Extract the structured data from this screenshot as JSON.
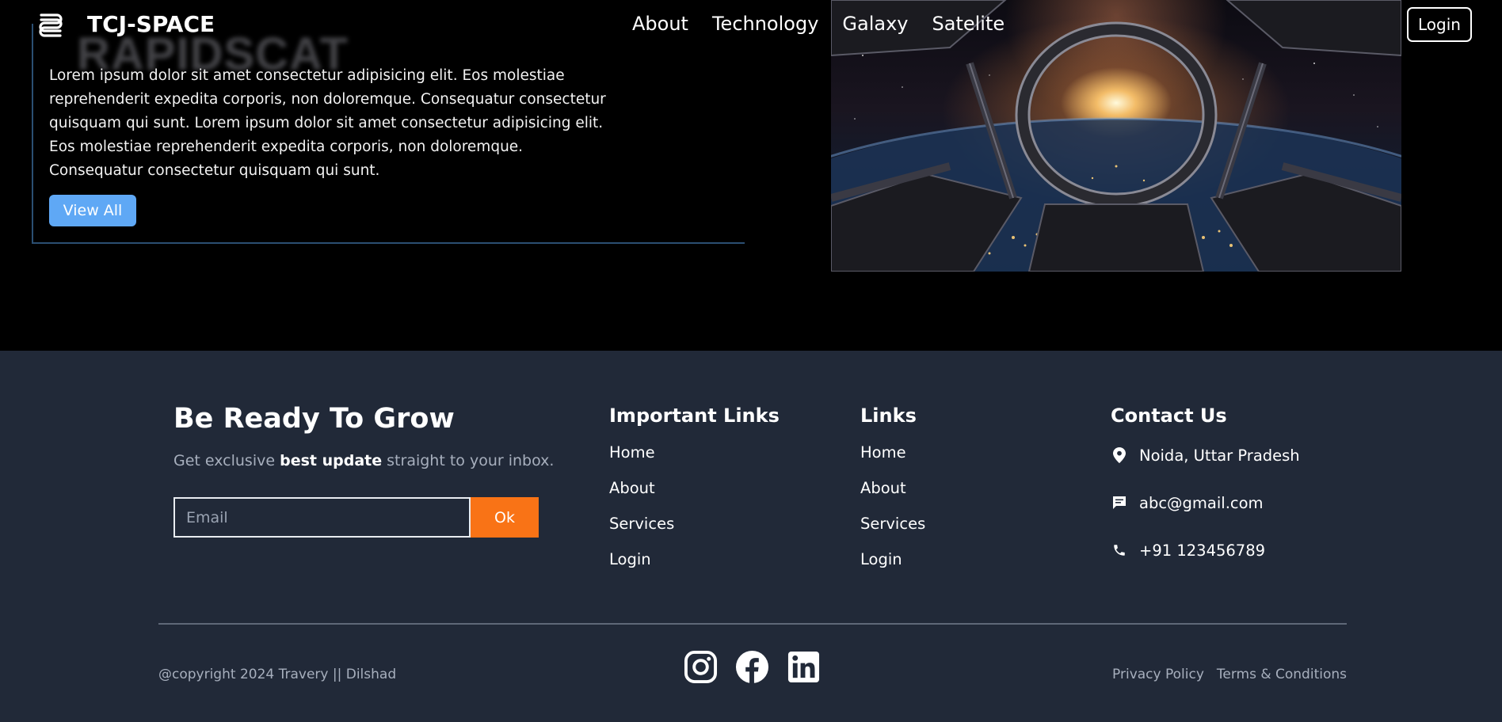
{
  "navbar": {
    "brand": "TCJ-SPACE",
    "links": [
      "About",
      "Technology",
      "Galaxy",
      "Satelite"
    ],
    "login_label": "Login"
  },
  "hero": {
    "ghost_word": "RAPIDSCAT",
    "paragraph": "Lorem ipsum dolor sit amet consectetur adipisicing elit. Eos molestiae reprehenderit expedita corporis, non doloremque. Consequatur consectetur quisquam qui sunt. Lorem ipsum dolor sit amet consectetur adipisicing elit. Eos molestiae reprehenderit expedita corporis, non doloremque. Consequatur consectetur quisquam qui sunt.",
    "button_label": "View All",
    "image_icon": "space-station-window-image"
  },
  "newsletter": {
    "title": "Be Ready To Grow",
    "subtitle_before": "Get exclusive",
    "subtitle_bold": "best update",
    "subtitle_after": "straight to your inbox.",
    "email_placeholder": "Email",
    "email_value": "",
    "ok_label": "Ok"
  },
  "important_links": {
    "title": "Important Links",
    "items": [
      "Home",
      "About",
      "Services",
      "Login"
    ]
  },
  "links": {
    "title": "Links",
    "items": [
      "Home",
      "About",
      "Services",
      "Login"
    ]
  },
  "contact": {
    "title": "Contact Us",
    "address": "Noida, Uttar Pradesh",
    "email": "abc@gmail.com",
    "phone": "+91 123456789",
    "icons": [
      "location-pin-icon",
      "message-icon",
      "phone-icon"
    ]
  },
  "bottom": {
    "copyright": "@copyright 2024 Travery || Dilshad",
    "socials": [
      "instagram-icon",
      "facebook-icon",
      "linkedin-icon"
    ],
    "privacy": "Privacy Policy",
    "terms": "Terms & Conditions"
  },
  "colors": {
    "hero_bg": "#000000",
    "footer_bg": "#212938",
    "button_blue": "#5fa8f5",
    "accent_orange": "#f97316",
    "card_border": "#2b4f72"
  }
}
